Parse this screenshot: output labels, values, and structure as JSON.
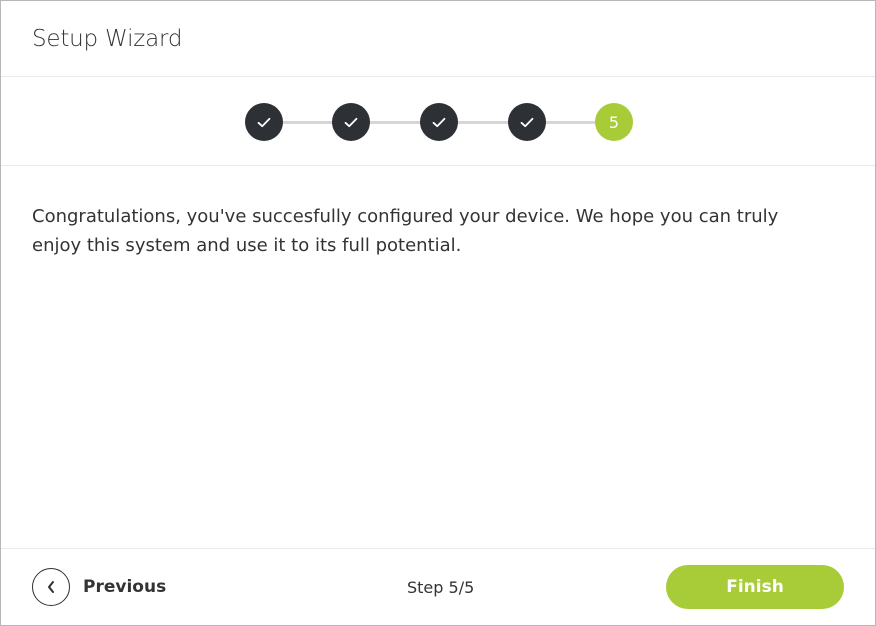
{
  "header": {
    "title": "Setup Wizard"
  },
  "stepper": {
    "steps": [
      {
        "status": "done",
        "icon": "check-icon"
      },
      {
        "status": "done",
        "icon": "check-icon"
      },
      {
        "status": "done",
        "icon": "check-icon"
      },
      {
        "status": "done",
        "icon": "check-icon"
      },
      {
        "status": "active",
        "label": "5"
      }
    ],
    "colors": {
      "done": "#2d3035",
      "active": "#a7cc38",
      "track": "#d6d6d6"
    }
  },
  "content": {
    "message": "Congratulations, you've succesfully configured your device. We hope you can truly enjoy this system and use it to its full potential."
  },
  "footer": {
    "previous_label": "Previous",
    "previous_icon": "chevron-left-icon",
    "step_counter": "Step 5/5",
    "finish_label": "Finish"
  }
}
